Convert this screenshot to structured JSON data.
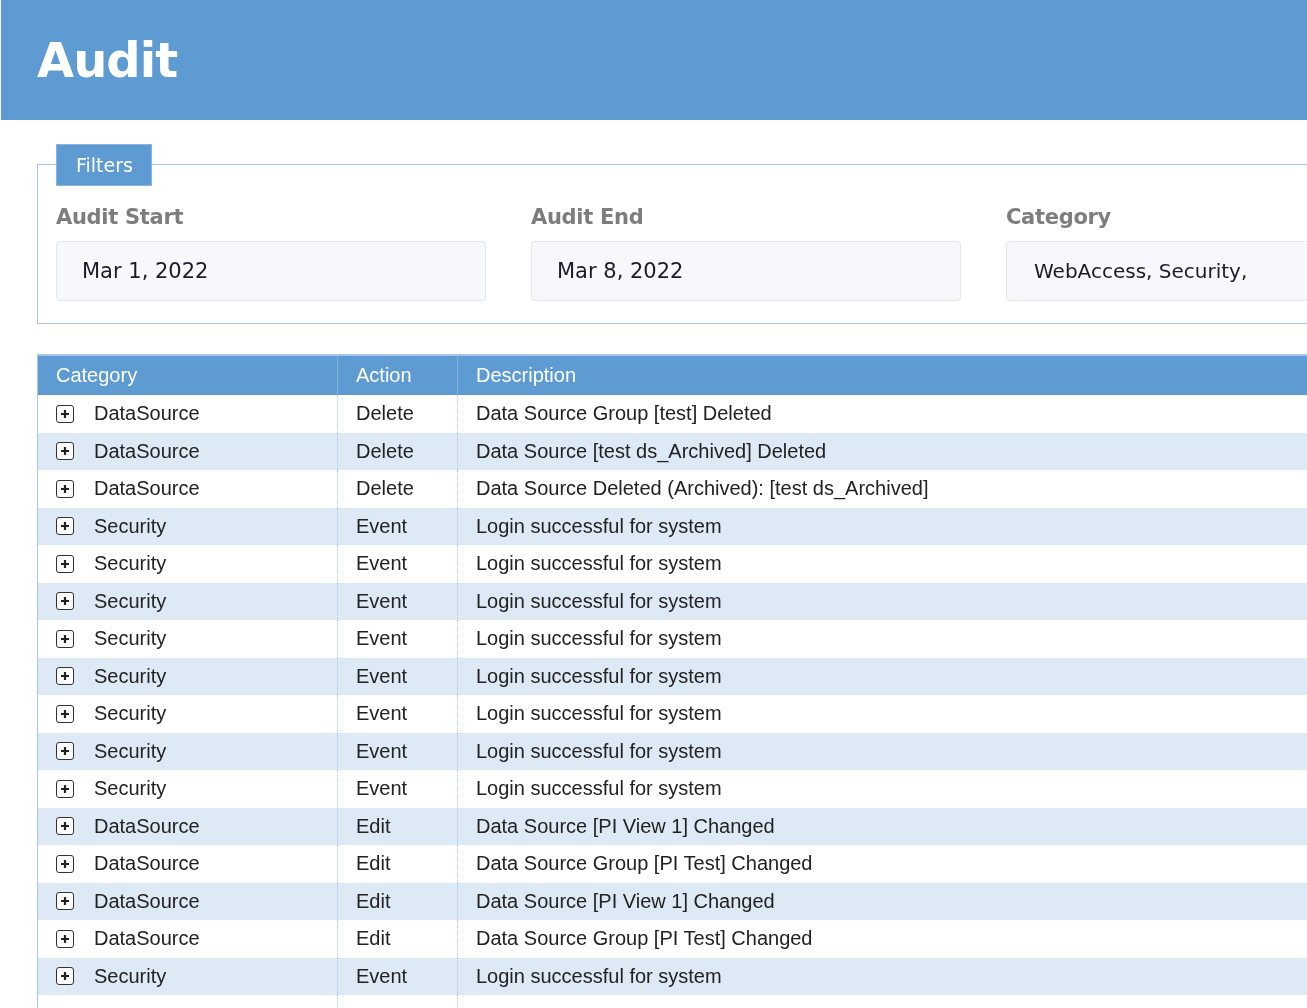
{
  "header": {
    "title": "Audit"
  },
  "filters": {
    "legend": "Filters",
    "fields": [
      {
        "label": "Audit Start",
        "value": "Mar 1, 2022"
      },
      {
        "label": "Audit End",
        "value": "Mar 8, 2022"
      },
      {
        "label": "Category",
        "value": "WebAccess, Security,"
      }
    ]
  },
  "table": {
    "columns": [
      "Category",
      "Action",
      "Description"
    ],
    "rows": [
      {
        "category": "DataSource",
        "action": "Delete",
        "description": "Data Source Group [test] Deleted",
        "expanded": false
      },
      {
        "category": "DataSource",
        "action": "Delete",
        "description": "Data Source [test ds_Archived] Deleted",
        "expanded": false
      },
      {
        "category": "DataSource",
        "action": "Delete",
        "description": "Data Source Deleted (Archived): [test ds_Archived]",
        "expanded": false
      },
      {
        "category": "Security",
        "action": "Event",
        "description": "Login successful for system",
        "expanded": false
      },
      {
        "category": "Security",
        "action": "Event",
        "description": "Login successful for system",
        "expanded": false
      },
      {
        "category": "Security",
        "action": "Event",
        "description": "Login successful for system",
        "expanded": false
      },
      {
        "category": "Security",
        "action": "Event",
        "description": "Login successful for system",
        "expanded": false
      },
      {
        "category": "Security",
        "action": "Event",
        "description": "Login successful for system",
        "expanded": false
      },
      {
        "category": "Security",
        "action": "Event",
        "description": "Login successful for system",
        "expanded": false
      },
      {
        "category": "Security",
        "action": "Event",
        "description": "Login successful for system",
        "expanded": false
      },
      {
        "category": "Security",
        "action": "Event",
        "description": "Login successful for system",
        "expanded": false
      },
      {
        "category": "DataSource",
        "action": "Edit",
        "description": "Data Source [PI View 1] Changed",
        "expanded": false
      },
      {
        "category": "DataSource",
        "action": "Edit",
        "description": "Data Source Group [PI Test] Changed",
        "expanded": false
      },
      {
        "category": "DataSource",
        "action": "Edit",
        "description": "Data Source [PI View 1] Changed",
        "expanded": false
      },
      {
        "category": "DataSource",
        "action": "Edit",
        "description": "Data Source Group [PI Test] Changed",
        "expanded": false
      },
      {
        "category": "Security",
        "action": "Event",
        "description": "Login successful for system",
        "expanded": false
      }
    ]
  }
}
